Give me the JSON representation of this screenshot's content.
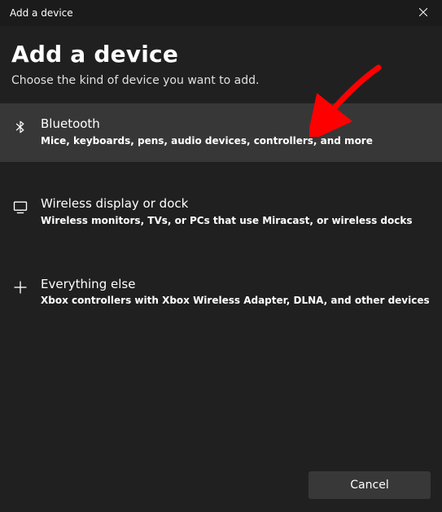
{
  "titlebar": {
    "title": "Add a device"
  },
  "heading": "Add a device",
  "subheading": "Choose the kind of device you want to add.",
  "options": [
    {
      "title": "Bluetooth",
      "desc": "Mice, keyboards, pens, audio devices, controllers, and more"
    },
    {
      "title": "Wireless display or dock",
      "desc": "Wireless monitors, TVs, or PCs that use Miracast, or wireless docks"
    },
    {
      "title": "Everything else",
      "desc": "Xbox controllers with Xbox Wireless Adapter, DLNA, and other devices"
    }
  ],
  "footer": {
    "cancel": "Cancel"
  },
  "annotation": {
    "arrow_color": "#ff0000"
  }
}
